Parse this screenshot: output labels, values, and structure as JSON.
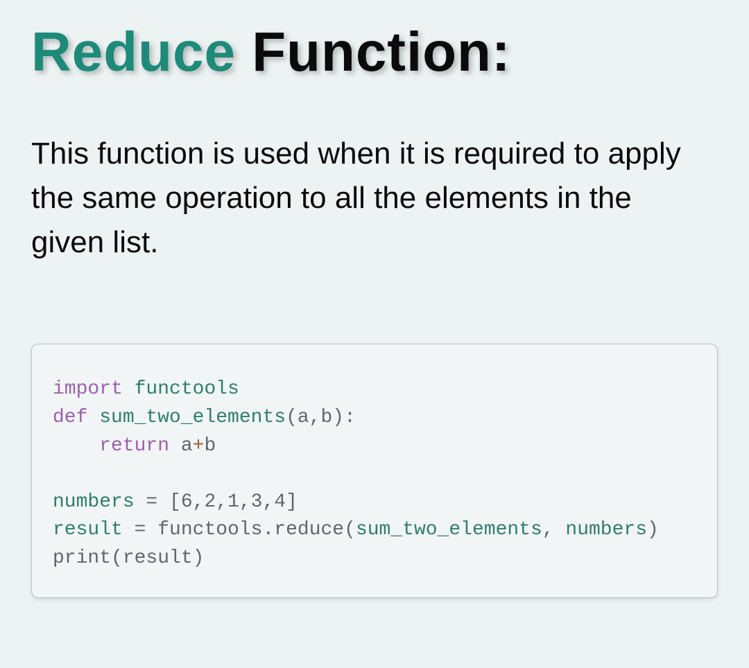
{
  "title": {
    "accent": "Reduce",
    "main": " Function:"
  },
  "description": "This function is used when it is required to apply the same operation to all the elements in the given list.",
  "code": {
    "line1_import": "import",
    "line1_module": " functools",
    "line2_def": "def",
    "line2_func": " sum_two_elements",
    "line2_params": "(a,b):",
    "line3_indent": "    ",
    "line3_return": "return",
    "line3_expr_a": " a",
    "line3_expr_op": "+",
    "line3_expr_b": "b",
    "line4_blank": "",
    "line5_var": "numbers",
    "line5_assign": " = ",
    "line5_list": "[6,2,1,3,4]",
    "line6_var": "result",
    "line6_assign": " = ",
    "line6_mod": "functools",
    "line6_dot": ".",
    "line6_method": "reduce",
    "line6_open": "(",
    "line6_arg1": "sum_two_elements",
    "line6_comma": ", ",
    "line6_arg2": "numbers",
    "line6_close": ")",
    "line7_print": "print",
    "line7_open": "(",
    "line7_arg": "result",
    "line7_close": ")"
  }
}
